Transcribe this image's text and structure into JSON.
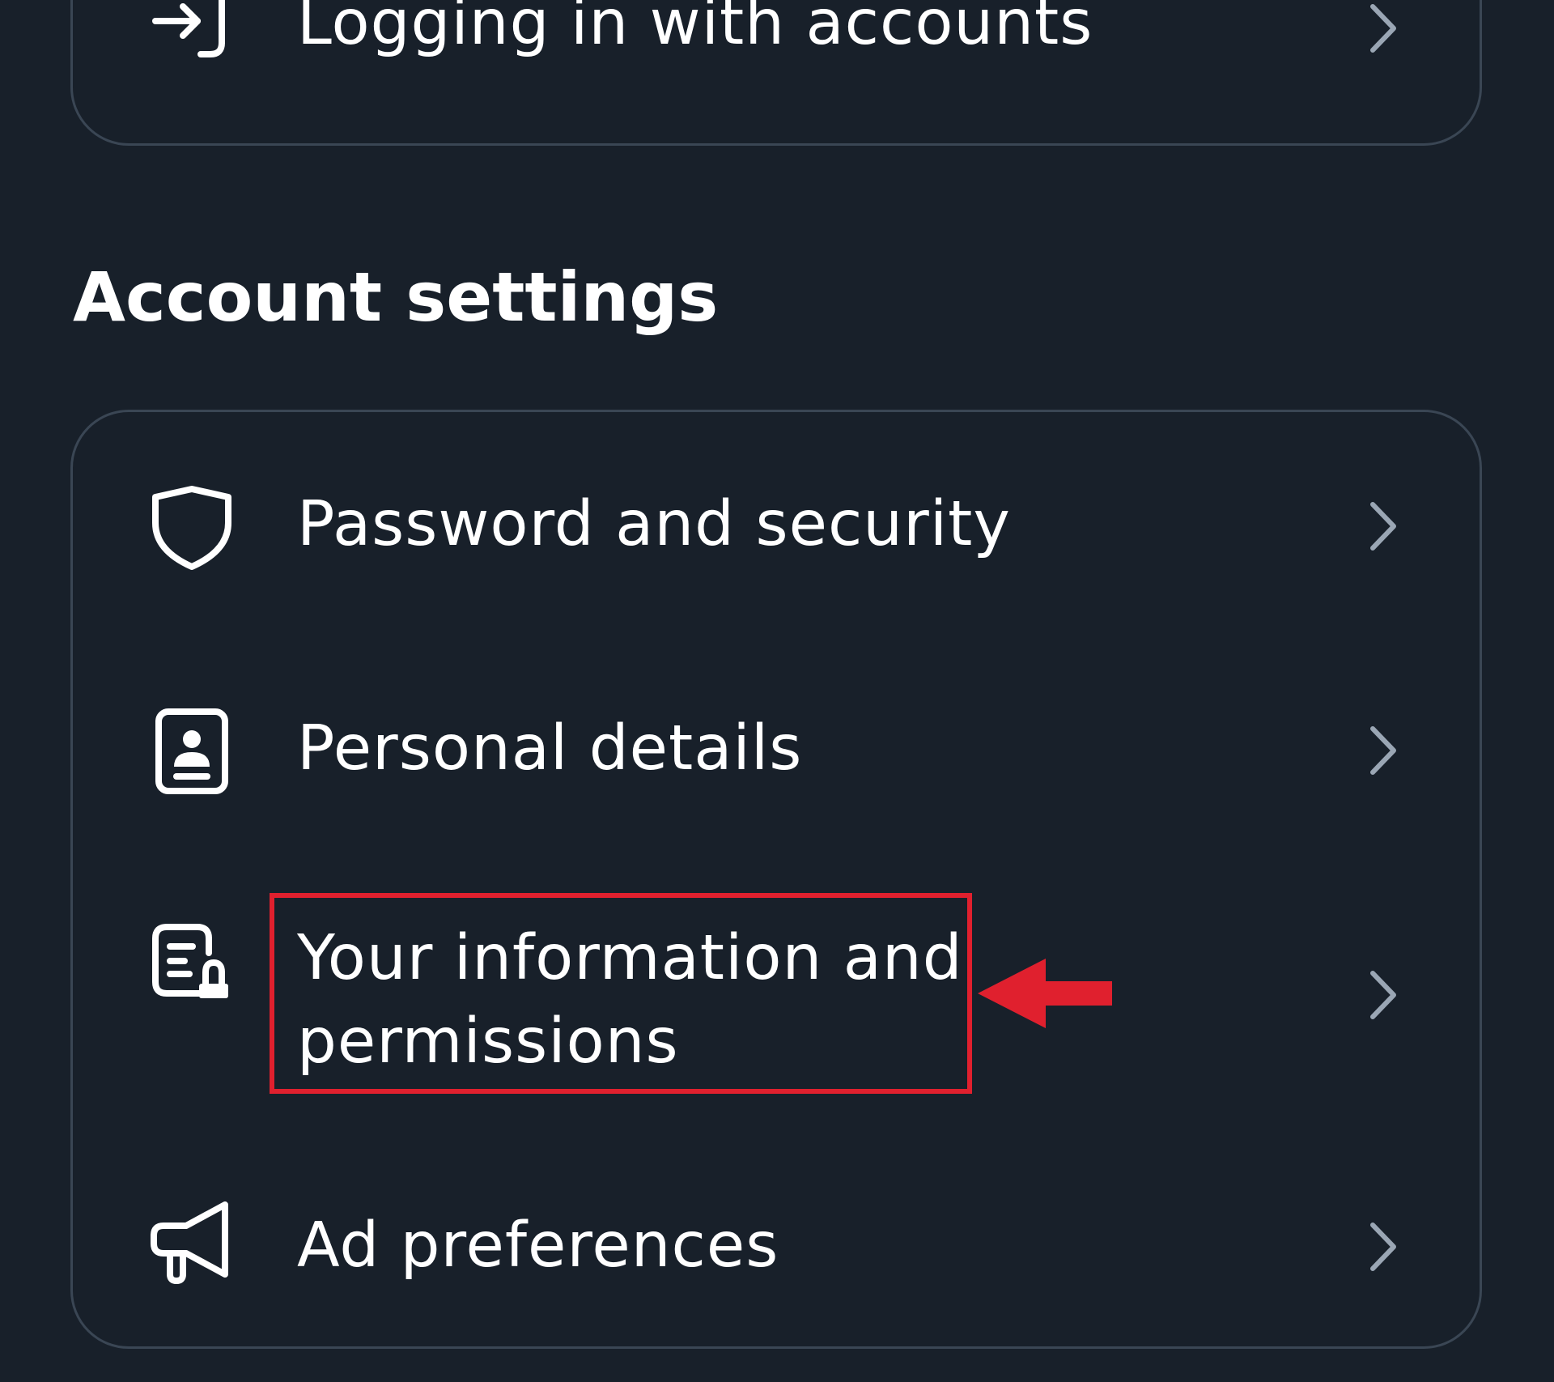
{
  "colors": {
    "background": "#18202a",
    "card_border": "#3a4654",
    "text": "#ffffff",
    "chevron": "#9aa6b4",
    "highlight": "#e0202e"
  },
  "top_card": {
    "item": {
      "label": "Logging in with accounts",
      "icon": "login-arrow-icon"
    }
  },
  "account_settings": {
    "title": "Account settings",
    "items": [
      {
        "label": "Password and security",
        "icon": "shield-icon"
      },
      {
        "label": "Personal details",
        "icon": "id-card-icon"
      },
      {
        "label": "Your information and permissions",
        "icon": "document-lock-icon"
      },
      {
        "label": "Ad preferences",
        "icon": "megaphone-icon"
      }
    ]
  },
  "annotation": {
    "highlighted_item": "Your information and permissions",
    "marker": "red-arrow-icon"
  }
}
